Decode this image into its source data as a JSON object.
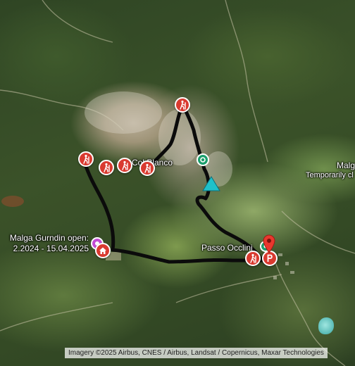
{
  "map": {
    "labels": {
      "peak": "Col Blanco",
      "pass": "Passo Occlini",
      "malga_right_line1": "Malga",
      "malga_right_line2": "Temporarily cl",
      "hut_line1": "Malga Gurndin open:",
      "hut_line2": "2.2024 - 15.04.2025"
    },
    "markers": {
      "hiking_icon": "hiking-icon",
      "home_icon": "home-icon",
      "parking_icon": "parking-icon",
      "peak_icon": "summit-triangle-icon",
      "colors": {
        "pin_red": "#d93a30",
        "poi_green": "#1a9e6c",
        "hut_purple": "#c34bd3",
        "summit_cyan": "#1fc1c9",
        "route_black": "#0b0b0b"
      }
    },
    "attribution": "Imagery ©2025 Airbus, CNES / Airbus, Landsat / Copernicus, Maxar Technologies"
  }
}
